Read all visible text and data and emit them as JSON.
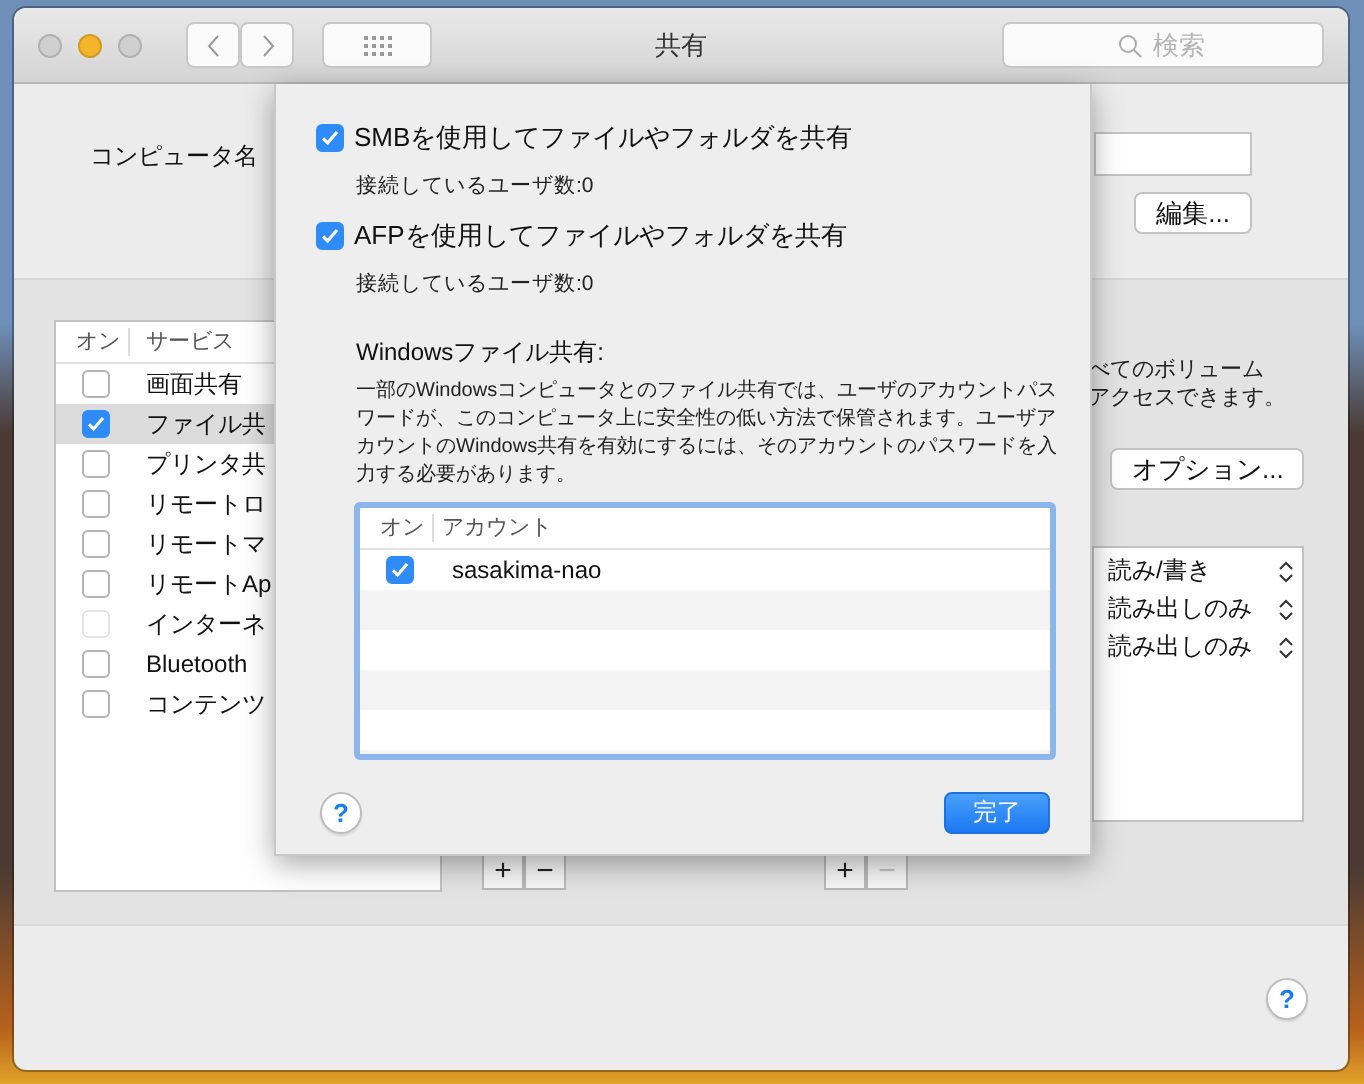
{
  "window": {
    "title": "共有",
    "search": {
      "placeholder": "検索"
    }
  },
  "computer_name": {
    "label": "コンピュータ名",
    "edit_button": "編集..."
  },
  "services": {
    "columns": [
      "オン",
      "サービス"
    ],
    "rows": [
      {
        "name": "画面共有",
        "checked": false,
        "selected": false,
        "disabled": false
      },
      {
        "name": "ファイル共",
        "checked": true,
        "selected": true,
        "disabled": false
      },
      {
        "name": "プリンタ共",
        "checked": false,
        "selected": false,
        "disabled": false
      },
      {
        "name": "リモートロ",
        "checked": false,
        "selected": false,
        "disabled": false
      },
      {
        "name": "リモートマ",
        "checked": false,
        "selected": false,
        "disabled": false
      },
      {
        "name": "リモートAp",
        "checked": false,
        "selected": false,
        "disabled": false
      },
      {
        "name": "インターネ",
        "checked": false,
        "selected": false,
        "disabled": true
      },
      {
        "name": "Bluetooth",
        "checked": false,
        "selected": false,
        "disabled": false
      },
      {
        "name": "コンテンツ",
        "checked": false,
        "selected": false,
        "disabled": false
      }
    ]
  },
  "list_buttons": [
    {
      "add": "+",
      "remove": "−",
      "remove_disabled": false
    },
    {
      "add": "+",
      "remove": "−",
      "remove_disabled": true
    }
  ],
  "info_text": [
    "べてのボリューム",
    "アクセスできます。"
  ],
  "options_button": "オプション...",
  "permissions": [
    {
      "label": "読み/書き"
    },
    {
      "label": "読み出しのみ"
    },
    {
      "label": "読み出しのみ"
    }
  ],
  "help_button": "?",
  "sheet": {
    "protocols": [
      {
        "label": "SMBを使用してファイルやフォルダを共有",
        "checked": true,
        "status": "接続しているユーザ数:0"
      },
      {
        "label": "AFPを使用してファイルやフォルダを共有",
        "checked": true,
        "status": "接続しているユーザ数:0"
      }
    ],
    "windows_heading": "Windowsファイル共有:",
    "windows_description": "一部のWindowsコンピュータとのファイル共有では、ユーザのアカウントパスワードが、このコンピュータ上に安全性の低い方法で保管されます。ユーザアカウントのWindows共有を有効にするには、そのアカウントのパスワードを入力する必要があります。",
    "accounts": {
      "columns": [
        "オン",
        "アカウント"
      ],
      "rows": [
        {
          "name": "sasakima-nao",
          "checked": true
        }
      ]
    },
    "help_button": "?",
    "done_button": "完了"
  }
}
